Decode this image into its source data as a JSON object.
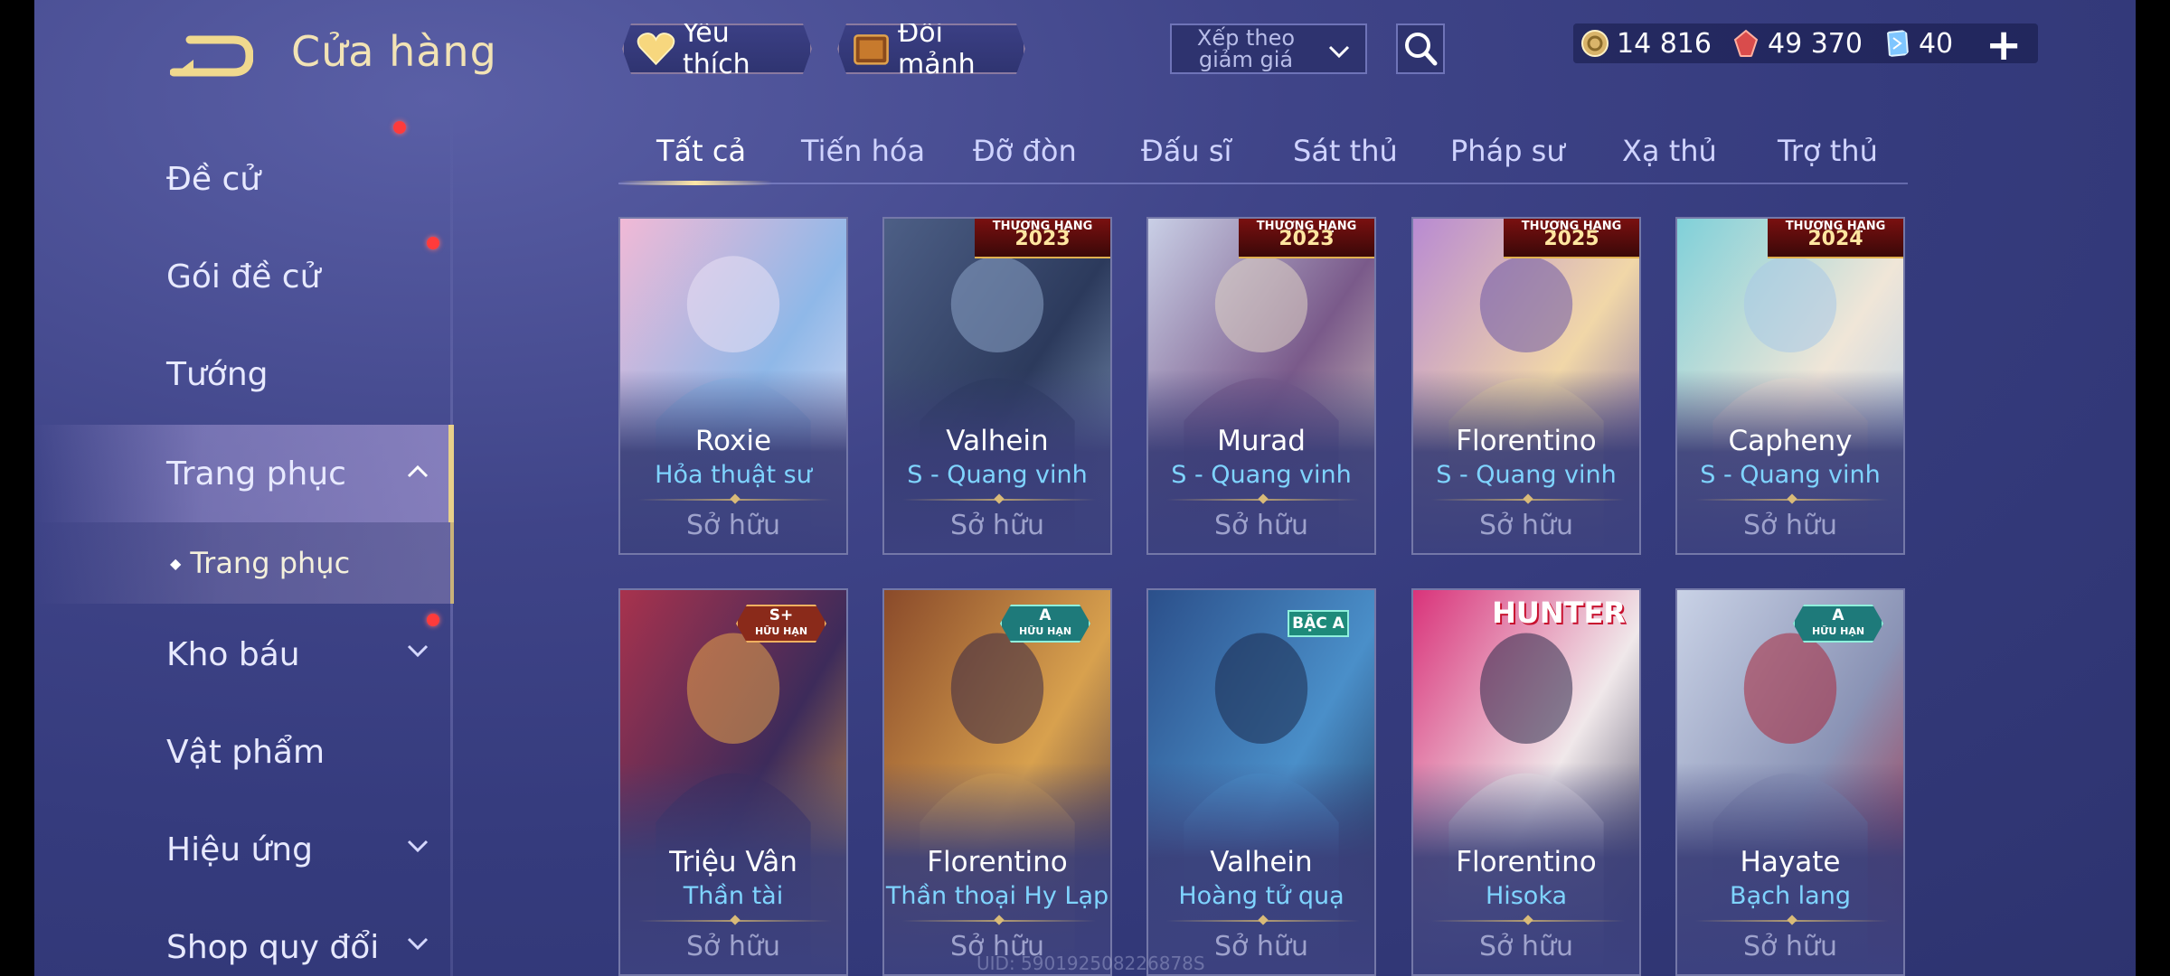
{
  "header": {
    "title": "Cửa hàng",
    "favorite_label": "Yêu thích",
    "exchange_label": "Đổi mảnh",
    "sort_label": "Xếp theo giảm giá"
  },
  "currencies": [
    {
      "icon": "gold-coin-icon",
      "value": "14 816"
    },
    {
      "icon": "red-gem-icon",
      "value": "49 370"
    },
    {
      "icon": "voucher-icon",
      "value": "40"
    }
  ],
  "sidebar": {
    "items": [
      {
        "label": "Đề cử"
      },
      {
        "label": "Gói đề cử"
      },
      {
        "label": "Tướng"
      },
      {
        "label": "Trang phục"
      },
      {
        "label": "Kho báu"
      },
      {
        "label": "Vật phẩm"
      },
      {
        "label": "Hiệu ứng"
      },
      {
        "label": "Shop quy đổi"
      }
    ],
    "subitem": "Trang phục"
  },
  "tabs": [
    "Tất cả",
    "Tiến hóa",
    "Đỡ đòn",
    "Đấu sĩ",
    "Sát thủ",
    "Pháp sư",
    "Xạ thủ",
    "Trợ thủ"
  ],
  "cards": [
    {
      "hero": "Roxie",
      "skin": "Hỏa thuật sư",
      "status": "Sở hữu",
      "badge": ""
    },
    {
      "hero": "Valhein",
      "skin": "S - Quang vinh",
      "status": "Sở hữu",
      "badge": "2023"
    },
    {
      "hero": "Murad",
      "skin": "S - Quang vinh",
      "status": "Sở hữu",
      "badge": "2023"
    },
    {
      "hero": "Florentino",
      "skin": "S - Quang vinh",
      "status": "Sở hữu",
      "badge": "2025"
    },
    {
      "hero": "Capheny",
      "skin": "S - Quang vinh",
      "status": "Sở hữu",
      "badge": "2024"
    },
    {
      "hero": "Triệu Vân",
      "skin": "Thần tài",
      "status": "Sở hữu",
      "badge": "S+"
    },
    {
      "hero": "Florentino",
      "skin": "Thần thoại Hy Lạp",
      "status": "Sở hữu",
      "badge": "A"
    },
    {
      "hero": "Valhein",
      "skin": "Hoàng tử quạ",
      "status": "Sở hữu",
      "badge": "BẬC A"
    },
    {
      "hero": "Florentino",
      "skin": "Hisoka",
      "status": "Sở hữu",
      "badge": "HUNTER"
    },
    {
      "hero": "Hayate",
      "skin": "Bạch lang",
      "status": "Sở hữu",
      "badge": "A"
    }
  ],
  "badges": {
    "rank": "THƯỢNG HẠNG",
    "limited": "HỮU HẠN"
  },
  "uid": "UID: 590192508226878S"
}
